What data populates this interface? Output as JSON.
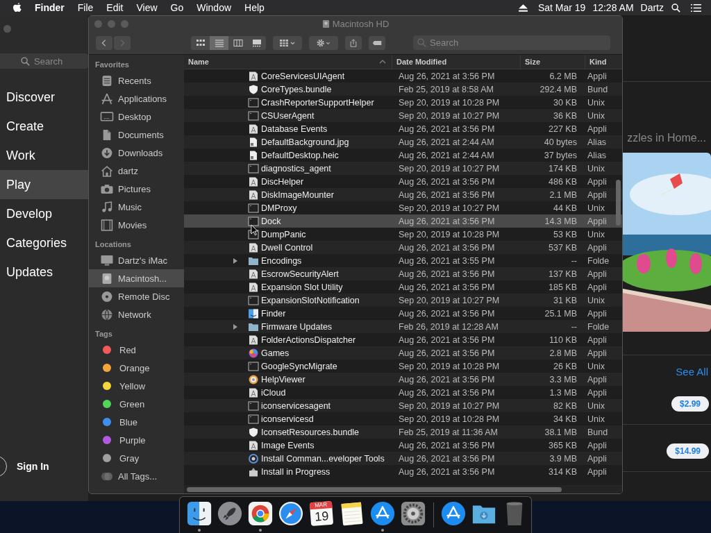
{
  "menu_bar": {
    "app": "Finder",
    "menus": [
      "File",
      "Edit",
      "View",
      "Go",
      "Window",
      "Help"
    ],
    "date": "Sat Mar 19",
    "time": "12:28 AM",
    "user": "Dartz"
  },
  "app_store": {
    "search": {
      "placeholder": "Search"
    },
    "nav": [
      {
        "label": "Discover",
        "selected": false
      },
      {
        "label": "Create",
        "selected": false
      },
      {
        "label": "Work",
        "selected": false
      },
      {
        "label": "Play",
        "selected": true
      },
      {
        "label": "Develop",
        "selected": false
      },
      {
        "label": "Categories",
        "selected": false
      },
      {
        "label": "Updates",
        "selected": false
      }
    ],
    "sign_in": "Sign In",
    "section_title": "zzles in Home...",
    "see_all": "See All",
    "prices": [
      "$2.99",
      "$14.99"
    ]
  },
  "finder": {
    "title": "Macintosh HD",
    "view_modes": [
      {
        "kind": "icons",
        "selected": false
      },
      {
        "kind": "list",
        "selected": true
      },
      {
        "kind": "columns",
        "selected": false
      },
      {
        "kind": "gallery",
        "selected": false
      }
    ],
    "search": {
      "placeholder": "Search"
    },
    "sidebar": [
      {
        "heading": "Favorites",
        "items": [
          {
            "label": "Recents",
            "kind": "recents",
            "selected": false
          },
          {
            "label": "Applications",
            "kind": "applications",
            "selected": false
          },
          {
            "label": "Desktop",
            "kind": "desktop",
            "selected": false
          },
          {
            "label": "Documents",
            "kind": "documents",
            "selected": false
          },
          {
            "label": "Downloads",
            "kind": "downloads",
            "selected": false
          },
          {
            "label": "dartz",
            "kind": "home",
            "selected": false
          },
          {
            "label": "Pictures",
            "kind": "pictures",
            "selected": false
          },
          {
            "label": "Music",
            "kind": "music",
            "selected": false
          },
          {
            "label": "Movies",
            "kind": "movies",
            "selected": false
          }
        ]
      },
      {
        "heading": "Locations",
        "items": [
          {
            "label": "Dartz's iMac",
            "kind": "computer",
            "selected": false
          },
          {
            "label": "Macintosh...",
            "kind": "disk",
            "selected": true
          },
          {
            "label": "Remote Disc",
            "kind": "disc",
            "selected": false
          },
          {
            "label": "Network",
            "kind": "network",
            "selected": false
          }
        ]
      },
      {
        "heading": "Tags",
        "items": [
          {
            "label": "Red",
            "kind": "tag",
            "color": "#f05a5a",
            "selected": false
          },
          {
            "label": "Orange",
            "kind": "tag",
            "color": "#f5a33c",
            "selected": false
          },
          {
            "label": "Yellow",
            "kind": "tag",
            "color": "#f5d63c",
            "selected": false
          },
          {
            "label": "Green",
            "kind": "tag",
            "color": "#52d65a",
            "selected": false
          },
          {
            "label": "Blue",
            "kind": "tag",
            "color": "#3d8ff0",
            "selected": false
          },
          {
            "label": "Purple",
            "kind": "tag",
            "color": "#b45ae0",
            "selected": false
          },
          {
            "label": "Gray",
            "kind": "tag",
            "color": "#a0a0a0",
            "selected": false
          },
          {
            "label": "All Tags...",
            "kind": "all-tags",
            "selected": false
          }
        ]
      }
    ],
    "columns": [
      {
        "label": "Name",
        "sorted": true
      },
      {
        "label": "Date Modified",
        "sorted": false
      },
      {
        "label": "Size",
        "sorted": false
      },
      {
        "label": "Kind",
        "sorted": false
      }
    ],
    "rows": [
      {
        "name": "CoreServicesUIAgent",
        "kind": "app",
        "date": "Aug 26, 2021 at 3:56 PM",
        "size": "6.2 MB",
        "type": "Appli",
        "selected": false
      },
      {
        "name": "CoreTypes.bundle",
        "kind": "bundle",
        "date": "Feb 25, 2019 at 8:58 AM",
        "size": "292.4 MB",
        "type": "Bund",
        "selected": false
      },
      {
        "name": "CrashReporterSupportHelper",
        "kind": "exec",
        "date": "Sep 20, 2019 at 10:28 PM",
        "size": "30 KB",
        "type": "Unix",
        "selected": false
      },
      {
        "name": "CSUserAgent",
        "kind": "exec",
        "date": "Sep 20, 2019 at 10:27 PM",
        "size": "36 KB",
        "type": "Unix",
        "selected": false
      },
      {
        "name": "Database Events",
        "kind": "app",
        "date": "Aug 26, 2021 at 3:56 PM",
        "size": "227 KB",
        "type": "Appli",
        "selected": false
      },
      {
        "name": "DefaultBackground.jpg",
        "kind": "alias",
        "date": "Aug 26, 2021 at 2:44 AM",
        "size": "40 bytes",
        "type": "Alias",
        "selected": false
      },
      {
        "name": "DefaultDesktop.heic",
        "kind": "alias",
        "date": "Aug 26, 2021 at 2:44 AM",
        "size": "37 bytes",
        "type": "Alias",
        "selected": false
      },
      {
        "name": "diagnostics_agent",
        "kind": "exec",
        "date": "Sep 20, 2019 at 10:27 PM",
        "size": "174 KB",
        "type": "Unix",
        "selected": false
      },
      {
        "name": "DiscHelper",
        "kind": "app",
        "date": "Aug 26, 2021 at 3:56 PM",
        "size": "486 KB",
        "type": "Appli",
        "selected": false
      },
      {
        "name": "DiskImageMounter",
        "kind": "app",
        "date": "Aug 26, 2021 at 3:56 PM",
        "size": "2.1 MB",
        "type": "Appli",
        "selected": false
      },
      {
        "name": "DMProxy",
        "kind": "exec",
        "date": "Sep 20, 2019 at 10:27 PM",
        "size": "44 KB",
        "type": "Unix",
        "selected": false
      },
      {
        "name": "Dock",
        "kind": "exec",
        "date": "Aug 26, 2021 at 3:56 PM",
        "size": "14.3 MB",
        "type": "Appli",
        "selected": true
      },
      {
        "name": "DumpPanic",
        "kind": "exec",
        "date": "Sep 20, 2019 at 10:28 PM",
        "size": "53 KB",
        "type": "Unix",
        "selected": false
      },
      {
        "name": "Dwell Control",
        "kind": "app",
        "date": "Aug 26, 2021 at 3:56 PM",
        "size": "537 KB",
        "type": "Appli",
        "selected": false
      },
      {
        "name": "Encodings",
        "kind": "folder",
        "date": "Aug 26, 2021 at 3:55 PM",
        "size": "--",
        "type": "Folde",
        "selected": false
      },
      {
        "name": "EscrowSecurityAlert",
        "kind": "app",
        "date": "Aug 26, 2021 at 3:56 PM",
        "size": "137 KB",
        "type": "Appli",
        "selected": false
      },
      {
        "name": "Expansion Slot Utility",
        "kind": "app",
        "date": "Aug 26, 2021 at 3:56 PM",
        "size": "185 KB",
        "type": "Appli",
        "selected": false
      },
      {
        "name": "ExpansionSlotNotification",
        "kind": "exec",
        "date": "Sep 20, 2019 at 10:27 PM",
        "size": "31 KB",
        "type": "Unix",
        "selected": false
      },
      {
        "name": "Finder",
        "kind": "finder",
        "date": "Aug 26, 2021 at 3:56 PM",
        "size": "25.1 MB",
        "type": "Appli",
        "selected": false
      },
      {
        "name": "Firmware Updates",
        "kind": "folder",
        "date": "Feb 26, 2019 at 12:28 AM",
        "size": "--",
        "type": "Folde",
        "selected": false
      },
      {
        "name": "FolderActionsDispatcher",
        "kind": "app",
        "date": "Aug 26, 2021 at 3:56 PM",
        "size": "110 KB",
        "type": "Appli",
        "selected": false
      },
      {
        "name": "Games",
        "kind": "games",
        "date": "Aug 26, 2021 at 3:56 PM",
        "size": "2.8 MB",
        "type": "Appli",
        "selected": false
      },
      {
        "name": "GoogleSyncMigrate",
        "kind": "exec",
        "date": "Sep 20, 2019 at 10:28 PM",
        "size": "26 KB",
        "type": "Unix",
        "selected": false
      },
      {
        "name": "HelpViewer",
        "kind": "help",
        "date": "Aug 26, 2021 at 3:56 PM",
        "size": "3.3 MB",
        "type": "Appli",
        "selected": false
      },
      {
        "name": "iCloud",
        "kind": "app",
        "date": "Aug 26, 2021 at 3:56 PM",
        "size": "1.3 MB",
        "type": "Appli",
        "selected": false
      },
      {
        "name": "iconservicesagent",
        "kind": "exec",
        "date": "Sep 20, 2019 at 10:27 PM",
        "size": "82 KB",
        "type": "Unix",
        "selected": false
      },
      {
        "name": "iconservicesd",
        "kind": "exec",
        "date": "Sep 20, 2019 at 10:28 PM",
        "size": "34 KB",
        "type": "Unix",
        "selected": false
      },
      {
        "name": "IconsetResources.bundle",
        "kind": "bundle",
        "date": "Feb 25, 2019 at 11:36 AM",
        "size": "38.1 MB",
        "type": "Bund",
        "selected": false
      },
      {
        "name": "Image Events",
        "kind": "app",
        "date": "Aug 26, 2021 at 3:56 PM",
        "size": "365 KB",
        "type": "Appli",
        "selected": false
      },
      {
        "name": "Install Comman...eveloper Tools",
        "kind": "installer",
        "date": "Aug 26, 2021 at 3:56 PM",
        "size": "3.9 MB",
        "type": "Appli",
        "selected": false
      },
      {
        "name": "Install in Progress",
        "kind": "package",
        "date": "Aug 26, 2021 at 3:56 PM",
        "size": "314 KB",
        "type": "Appli",
        "selected": false
      }
    ]
  },
  "dock": [
    {
      "kind": "finder",
      "running": true
    },
    {
      "kind": "launchpad",
      "running": false
    },
    {
      "kind": "browser",
      "running": true
    },
    {
      "kind": "safari",
      "running": false
    },
    {
      "kind": "calendar",
      "running": false,
      "month": "MAR",
      "day": "19"
    },
    {
      "kind": "notes",
      "running": false
    },
    {
      "kind": "appstore",
      "running": true
    },
    {
      "kind": "preferences",
      "running": false
    },
    {
      "kind": "separator",
      "running": false
    },
    {
      "kind": "appstore",
      "running": false
    },
    {
      "kind": "downloads",
      "running": false
    },
    {
      "kind": "trash",
      "running": false
    }
  ]
}
